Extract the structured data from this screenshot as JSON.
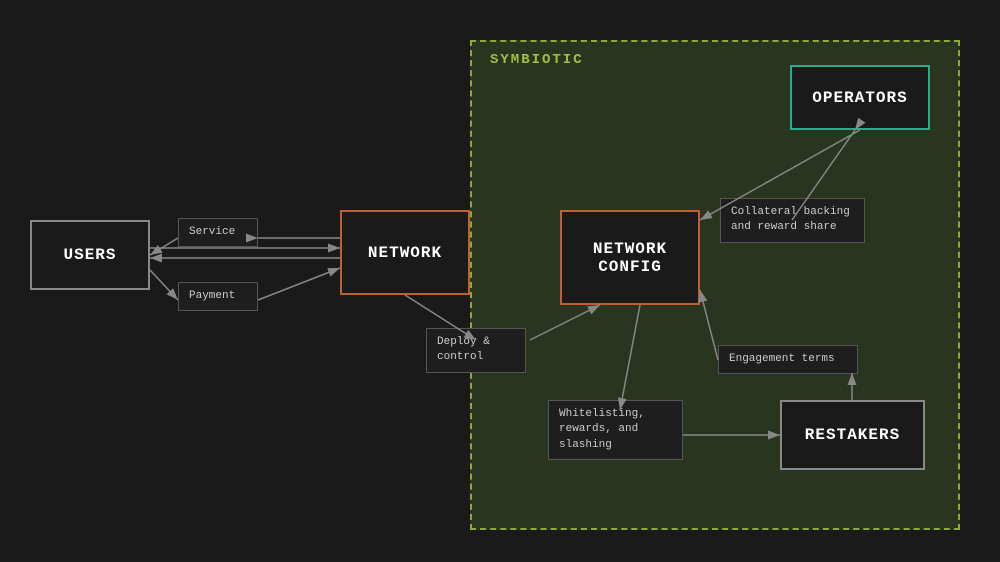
{
  "diagram": {
    "symbiotic_label": "SYMBIOTIC",
    "users_label": "USERS",
    "network_label": "NETWORK",
    "network_config_label": "NETWORK\nCONFIG",
    "operators_label": "OPERATORS",
    "restakers_label": "RESTAKERS",
    "service_label": "Service",
    "payment_label": "Payment",
    "deploy_label": "Deploy &\ncontrol",
    "collateral_label": "Collateral backing\nand reward share",
    "engagement_label": "Engagement terms",
    "whitelisting_label": "Whitelisting,\nrewards, and\nslashing"
  }
}
